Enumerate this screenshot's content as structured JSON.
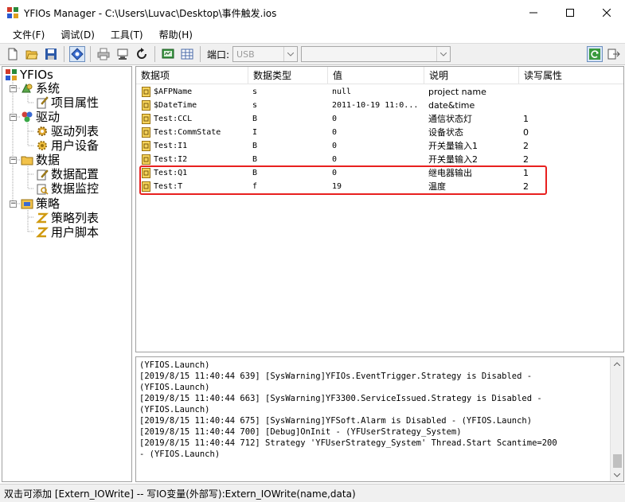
{
  "window": {
    "title": "YFIOs Manager - C:\\Users\\Luvac\\Desktop\\事件触发.ios"
  },
  "menubar": {
    "items": [
      "文件(F)",
      "调试(D)",
      "工具(T)",
      "帮助(H)"
    ]
  },
  "toolbar": {
    "port_label": "端口:",
    "port_value": "USB",
    "second_combo_value": "",
    "icons": [
      "new-file-icon",
      "open-folder-icon",
      "save-icon",
      "connect-icon",
      "print-icon",
      "device-icon",
      "refresh-icon",
      "monitor-icon",
      "grid-icon",
      "sync-icon",
      "exit-icon"
    ]
  },
  "tree": {
    "root": "YFIOs",
    "nodes": [
      {
        "label": "系统",
        "children": [
          "项目属性"
        ]
      },
      {
        "label": "驱动",
        "children": [
          "驱动列表",
          "用户设备"
        ]
      },
      {
        "label": "数据",
        "children": [
          "数据配置",
          "数据监控"
        ]
      },
      {
        "label": "策略",
        "children": [
          "策略列表",
          "用户脚本"
        ]
      }
    ]
  },
  "grid": {
    "columns": [
      "数据项",
      "数据类型",
      "值",
      "说明",
      "读写属性"
    ],
    "rows": [
      {
        "name": "$AFPName",
        "type": "s",
        "value": "null",
        "desc": "project name",
        "rw": ""
      },
      {
        "name": "$DateTime",
        "type": "s",
        "value": "2011-10-19 11:0...",
        "desc": "date&time",
        "rw": ""
      },
      {
        "name": "Test:CCL",
        "type": "B",
        "value": "0",
        "desc": "通信状态灯",
        "rw": "1"
      },
      {
        "name": "Test:CommState",
        "type": "I",
        "value": "0",
        "desc": "设备状态",
        "rw": "0"
      },
      {
        "name": "Test:I1",
        "type": "B",
        "value": "0",
        "desc": "开关量输入1",
        "rw": "2"
      },
      {
        "name": "Test:I2",
        "type": "B",
        "value": "0",
        "desc": "开关量输入2",
        "rw": "2"
      },
      {
        "name": "Test:Q1",
        "type": "B",
        "value": "0",
        "desc": "继电器输出",
        "rw": "1"
      },
      {
        "name": "Test:T",
        "type": "f",
        "value": "19",
        "desc": "温度",
        "rw": "2"
      }
    ]
  },
  "log": {
    "lines": [
      "(YFIOS.Launch)",
      "[2019/8/15 11:40:44 639] [SysWarning]YFIOs.EventTrigger.Strategy is Disabled -",
      "(YFIOS.Launch)",
      "[2019/8/15 11:40:44 663] [SysWarning]YF3300.ServiceIssued.Strategy is Disabled -",
      "(YFIOS.Launch)",
      "[2019/8/15 11:40:44 675] [SysWarning]YFSoft.Alarm is Disabled - (YFIOS.Launch)",
      "[2019/8/15 11:40:44 700] [Debug]OnInit - (YFUserStrategy_System)",
      "[2019/8/15 11:40:44 712] Strategy 'YFUserStrategy_System' Thread.Start Scantime=200",
      "- (YFIOS.Launch)"
    ]
  },
  "statusbar": {
    "text": "双击可添加 [Extern_IOWrite] -- 写IO变量(外部写):Extern_IOWrite(name,data)"
  },
  "colors": {
    "highlight": "#e8201f",
    "toolbar_bg": "#f0f0f0",
    "active_button": "#d8e6f7"
  }
}
